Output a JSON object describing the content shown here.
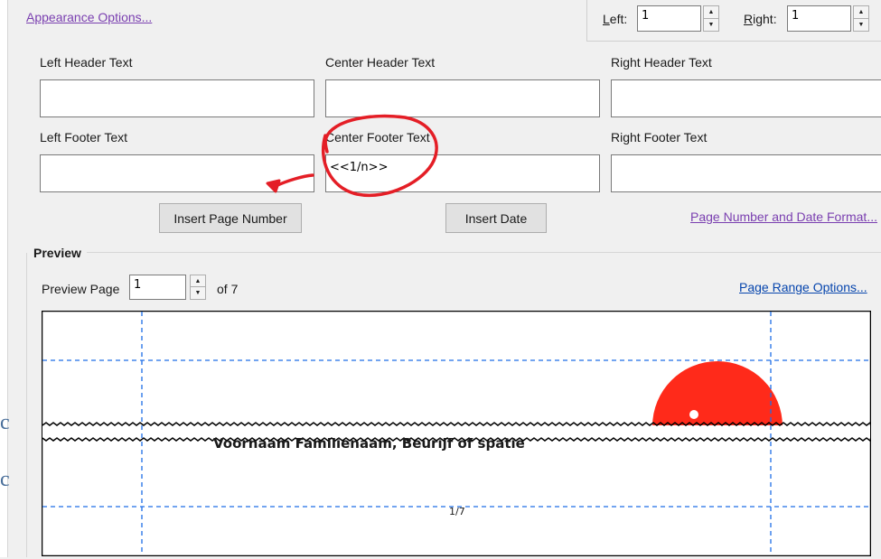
{
  "dialog": {
    "appearance_link": "Appearance Options...",
    "margins": {
      "left_label": "Left:",
      "left_value": "1",
      "right_label": "Right:",
      "right_value": "1"
    },
    "header_footer": {
      "left_header_label": "Left Header Text",
      "center_header_label": "Center Header Text",
      "right_header_label": "Right Header Text",
      "left_footer_label": "Left Footer Text",
      "center_footer_label": "Center Footer Text",
      "right_footer_label": "Right Footer Text",
      "left_header_value": "",
      "center_header_value": "",
      "right_header_value": "",
      "left_footer_value": "",
      "center_footer_value": "<<1/n>>",
      "right_footer_value": ""
    },
    "buttons": {
      "insert_page_number": "Insert Page Number",
      "insert_date": "Insert Date"
    },
    "format_link": "Page Number and Date Format...",
    "preview": {
      "section_title": "Preview",
      "page_label": "Preview Page",
      "page_value": "1",
      "of_label": "of 7",
      "range_link": "Page Range Options...",
      "content_text": "Voornaam Familienaam, Beurijf of spatie",
      "footer_page_text": "1/7"
    },
    "colors": {
      "annotation_red": "#e41e26",
      "guide_blue": "#1e6ee6",
      "logo_red": "#ff2a1a"
    }
  }
}
